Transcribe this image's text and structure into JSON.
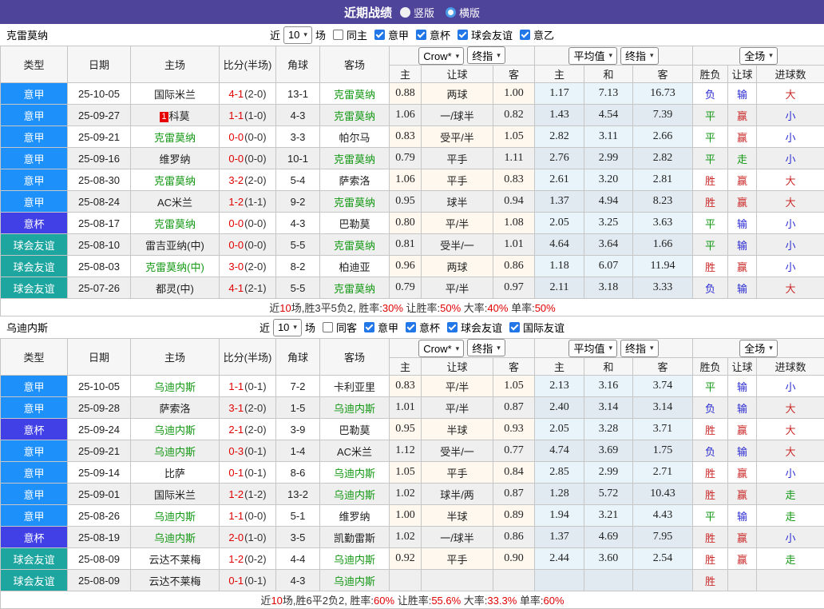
{
  "title_bar": {
    "title": "近期战绩",
    "vertical_label": "竖版",
    "horizontal_label": "横版"
  },
  "icons": {
    "dropdown": "▾"
  },
  "colors": {
    "title_bar": "#4e4499",
    "type_colors": {
      "意甲": "#1e90fa",
      "意杯": "#4140e6",
      "球会友谊": "#1da69f"
    },
    "team_focus": "#139813",
    "score": "#e00000",
    "result": {
      "r": "#cb2a2a",
      "g": "#139813",
      "b": "#2b2bd2"
    },
    "checkbox_checked": "#2176e8"
  },
  "table_header": {
    "left_columns": [
      "类型",
      "日期",
      "主场",
      "比分(半场)",
      "角球",
      "客场"
    ],
    "odds_group_selects": [
      "Crow*",
      "终指"
    ],
    "avg_group_selects": [
      "平均值",
      "终指"
    ],
    "result_group_select": "全场",
    "sub_columns": [
      "主",
      "让球",
      "客",
      "主",
      "和",
      "客",
      "胜负",
      "让球",
      "进球数"
    ]
  },
  "sections": [
    {
      "team": "克雷莫纳",
      "filter": {
        "near": "近",
        "count": "10",
        "games": "场",
        "scope": {
          "label": "同主",
          "checked": false
        },
        "leagues": [
          {
            "label": "意甲",
            "checked": true
          },
          {
            "label": "意杯",
            "checked": true
          },
          {
            "label": "球会友谊",
            "checked": true
          },
          {
            "label": "意乙",
            "checked": true
          }
        ]
      },
      "rows": [
        {
          "type": "意甲",
          "date": "25-10-05",
          "home": "国际米兰",
          "home_focus": false,
          "home_badge": "",
          "score": "4-1",
          "half": "(2-0)",
          "corner": "13-1",
          "away": "克雷莫纳",
          "away_focus": true,
          "odds": [
            "0.88",
            "两球",
            "1.00"
          ],
          "avg": [
            "1.17",
            "7.13",
            "16.73"
          ],
          "results": [
            [
              "负",
              "b"
            ],
            [
              "输",
              "b"
            ],
            [
              "大",
              "r"
            ]
          ]
        },
        {
          "type": "意甲",
          "date": "25-09-27",
          "home": "科莫",
          "home_focus": false,
          "home_badge": "1",
          "score": "1-1",
          "half": "(1-0)",
          "corner": "4-3",
          "away": "克雷莫纳",
          "away_focus": true,
          "odds": [
            "1.06",
            "一/球半",
            "0.82"
          ],
          "avg": [
            "1.43",
            "4.54",
            "7.39"
          ],
          "results": [
            [
              "平",
              "g"
            ],
            [
              "赢",
              "r"
            ],
            [
              "小",
              "b"
            ]
          ]
        },
        {
          "type": "意甲",
          "date": "25-09-21",
          "home": "克雷莫纳",
          "home_focus": true,
          "home_badge": "",
          "score": "0-0",
          "half": "(0-0)",
          "corner": "3-3",
          "away": "帕尔马",
          "away_focus": false,
          "odds": [
            "0.83",
            "受平/半",
            "1.05"
          ],
          "avg": [
            "2.82",
            "3.11",
            "2.66"
          ],
          "results": [
            [
              "平",
              "g"
            ],
            [
              "赢",
              "r"
            ],
            [
              "小",
              "b"
            ]
          ]
        },
        {
          "type": "意甲",
          "date": "25-09-16",
          "home": "维罗纳",
          "home_focus": false,
          "home_badge": "",
          "score": "0-0",
          "half": "(0-0)",
          "corner": "10-1",
          "away": "克雷莫纳",
          "away_focus": true,
          "odds": [
            "0.79",
            "平手",
            "1.11"
          ],
          "avg": [
            "2.76",
            "2.99",
            "2.82"
          ],
          "results": [
            [
              "平",
              "g"
            ],
            [
              "走",
              "g"
            ],
            [
              "小",
              "b"
            ]
          ]
        },
        {
          "type": "意甲",
          "date": "25-08-30",
          "home": "克雷莫纳",
          "home_focus": true,
          "home_badge": "",
          "score": "3-2",
          "half": "(2-0)",
          "corner": "5-4",
          "away": "萨索洛",
          "away_focus": false,
          "odds": [
            "1.06",
            "平手",
            "0.83"
          ],
          "avg": [
            "2.61",
            "3.20",
            "2.81"
          ],
          "results": [
            [
              "胜",
              "r"
            ],
            [
              "赢",
              "r"
            ],
            [
              "大",
              "r"
            ]
          ]
        },
        {
          "type": "意甲",
          "date": "25-08-24",
          "home": "AC米兰",
          "home_focus": false,
          "home_badge": "",
          "score": "1-2",
          "half": "(1-1)",
          "corner": "9-2",
          "away": "克雷莫纳",
          "away_focus": true,
          "odds": [
            "0.95",
            "球半",
            "0.94"
          ],
          "avg": [
            "1.37",
            "4.94",
            "8.23"
          ],
          "results": [
            [
              "胜",
              "r"
            ],
            [
              "赢",
              "r"
            ],
            [
              "大",
              "r"
            ]
          ]
        },
        {
          "type": "意杯",
          "date": "25-08-17",
          "home": "克雷莫纳",
          "home_focus": true,
          "home_badge": "",
          "score": "0-0",
          "half": "(0-0)",
          "corner": "4-3",
          "away": "巴勒莫",
          "away_focus": false,
          "odds": [
            "0.80",
            "平/半",
            "1.08"
          ],
          "avg": [
            "2.05",
            "3.25",
            "3.63"
          ],
          "results": [
            [
              "平",
              "g"
            ],
            [
              "输",
              "b"
            ],
            [
              "小",
              "b"
            ]
          ]
        },
        {
          "type": "球会友谊",
          "date": "25-08-10",
          "home": "雷吉亚纳(中)",
          "home_focus": false,
          "home_badge": "",
          "score": "0-0",
          "half": "(0-0)",
          "corner": "5-5",
          "away": "克雷莫纳",
          "away_focus": true,
          "odds": [
            "0.81",
            "受半/一",
            "1.01"
          ],
          "avg": [
            "4.64",
            "3.64",
            "1.66"
          ],
          "results": [
            [
              "平",
              "g"
            ],
            [
              "输",
              "b"
            ],
            [
              "小",
              "b"
            ]
          ]
        },
        {
          "type": "球会友谊",
          "date": "25-08-03",
          "home": "克雷莫纳(中)",
          "home_focus": true,
          "home_badge": "",
          "score": "3-0",
          "half": "(2-0)",
          "corner": "8-2",
          "away": "柏迪亚",
          "away_focus": false,
          "odds": [
            "0.96",
            "两球",
            "0.86"
          ],
          "avg": [
            "1.18",
            "6.07",
            "11.94"
          ],
          "results": [
            [
              "胜",
              "r"
            ],
            [
              "赢",
              "r"
            ],
            [
              "小",
              "b"
            ]
          ]
        },
        {
          "type": "球会友谊",
          "date": "25-07-26",
          "home": "都灵(中)",
          "home_focus": false,
          "home_badge": "",
          "score": "4-1",
          "half": "(2-1)",
          "corner": "5-5",
          "away": "克雷莫纳",
          "away_focus": true,
          "odds": [
            "0.79",
            "平/半",
            "0.97"
          ],
          "avg": [
            "2.11",
            "3.18",
            "3.33"
          ],
          "results": [
            [
              "负",
              "b"
            ],
            [
              "输",
              "b"
            ],
            [
              "大",
              "r"
            ]
          ]
        }
      ],
      "summary": [
        {
          "text": "近",
          "red": false
        },
        {
          "text": "10",
          "red": true
        },
        {
          "text": "场,胜3平5负2, 胜率:",
          "red": false
        },
        {
          "text": "30%",
          "red": true
        },
        {
          "text": " 让胜率:",
          "red": false
        },
        {
          "text": "50%",
          "red": true
        },
        {
          "text": " 大率:",
          "red": false
        },
        {
          "text": "40%",
          "red": true
        },
        {
          "text": " 单率:",
          "red": false
        },
        {
          "text": "50%",
          "red": true
        }
      ]
    },
    {
      "team": "乌迪内斯",
      "filter": {
        "near": "近",
        "count": "10",
        "games": "场",
        "scope": {
          "label": "同客",
          "checked": false
        },
        "leagues": [
          {
            "label": "意甲",
            "checked": true
          },
          {
            "label": "意杯",
            "checked": true
          },
          {
            "label": "球会友谊",
            "checked": true
          },
          {
            "label": "国际友谊",
            "checked": true
          }
        ]
      },
      "rows": [
        {
          "type": "意甲",
          "date": "25-10-05",
          "home": "乌迪内斯",
          "home_focus": true,
          "home_badge": "",
          "score": "1-1",
          "half": "(0-1)",
          "corner": "7-2",
          "away": "卡利亚里",
          "away_focus": false,
          "odds": [
            "0.83",
            "平/半",
            "1.05"
          ],
          "avg": [
            "2.13",
            "3.16",
            "3.74"
          ],
          "results": [
            [
              "平",
              "g"
            ],
            [
              "输",
              "b"
            ],
            [
              "小",
              "b"
            ]
          ]
        },
        {
          "type": "意甲",
          "date": "25-09-28",
          "home": "萨索洛",
          "home_focus": false,
          "home_badge": "",
          "score": "3-1",
          "half": "(2-0)",
          "corner": "1-5",
          "away": "乌迪内斯",
          "away_focus": true,
          "odds": [
            "1.01",
            "平/半",
            "0.87"
          ],
          "avg": [
            "2.40",
            "3.14",
            "3.14"
          ],
          "results": [
            [
              "负",
              "b"
            ],
            [
              "输",
              "b"
            ],
            [
              "大",
              "r"
            ]
          ]
        },
        {
          "type": "意杯",
          "date": "25-09-24",
          "home": "乌迪内斯",
          "home_focus": true,
          "home_badge": "",
          "score": "2-1",
          "half": "(2-0)",
          "corner": "3-9",
          "away": "巴勒莫",
          "away_focus": false,
          "odds": [
            "0.95",
            "半球",
            "0.93"
          ],
          "avg": [
            "2.05",
            "3.28",
            "3.71"
          ],
          "results": [
            [
              "胜",
              "r"
            ],
            [
              "赢",
              "r"
            ],
            [
              "大",
              "r"
            ]
          ]
        },
        {
          "type": "意甲",
          "date": "25-09-21",
          "home": "乌迪内斯",
          "home_focus": true,
          "home_badge": "",
          "score": "0-3",
          "half": "(0-1)",
          "corner": "1-4",
          "away": "AC米兰",
          "away_focus": false,
          "odds": [
            "1.12",
            "受半/一",
            "0.77"
          ],
          "avg": [
            "4.74",
            "3.69",
            "1.75"
          ],
          "results": [
            [
              "负",
              "b"
            ],
            [
              "输",
              "b"
            ],
            [
              "大",
              "r"
            ]
          ]
        },
        {
          "type": "意甲",
          "date": "25-09-14",
          "home": "比萨",
          "home_focus": false,
          "home_badge": "",
          "score": "0-1",
          "half": "(0-1)",
          "corner": "8-6",
          "away": "乌迪内斯",
          "away_focus": true,
          "odds": [
            "1.05",
            "平手",
            "0.84"
          ],
          "avg": [
            "2.85",
            "2.99",
            "2.71"
          ],
          "results": [
            [
              "胜",
              "r"
            ],
            [
              "赢",
              "r"
            ],
            [
              "小",
              "b"
            ]
          ]
        },
        {
          "type": "意甲",
          "date": "25-09-01",
          "home": "国际米兰",
          "home_focus": false,
          "home_badge": "",
          "score": "1-2",
          "half": "(1-2)",
          "corner": "13-2",
          "away": "乌迪内斯",
          "away_focus": true,
          "odds": [
            "1.02",
            "球半/两",
            "0.87"
          ],
          "avg": [
            "1.28",
            "5.72",
            "10.43"
          ],
          "results": [
            [
              "胜",
              "r"
            ],
            [
              "赢",
              "r"
            ],
            [
              "走",
              "g"
            ]
          ]
        },
        {
          "type": "意甲",
          "date": "25-08-26",
          "home": "乌迪内斯",
          "home_focus": true,
          "home_badge": "",
          "score": "1-1",
          "half": "(0-0)",
          "corner": "5-1",
          "away": "维罗纳",
          "away_focus": false,
          "odds": [
            "1.00",
            "半球",
            "0.89"
          ],
          "avg": [
            "1.94",
            "3.21",
            "4.43"
          ],
          "results": [
            [
              "平",
              "g"
            ],
            [
              "输",
              "b"
            ],
            [
              "走",
              "g"
            ]
          ]
        },
        {
          "type": "意杯",
          "date": "25-08-19",
          "home": "乌迪内斯",
          "home_focus": true,
          "home_badge": "",
          "score": "2-0",
          "half": "(1-0)",
          "corner": "3-5",
          "away": "凯勤雷斯",
          "away_focus": false,
          "odds": [
            "1.02",
            "一/球半",
            "0.86"
          ],
          "avg": [
            "1.37",
            "4.69",
            "7.95"
          ],
          "results": [
            [
              "胜",
              "r"
            ],
            [
              "赢",
              "r"
            ],
            [
              "小",
              "b"
            ]
          ]
        },
        {
          "type": "球会友谊",
          "date": "25-08-09",
          "home": "云达不莱梅",
          "home_focus": false,
          "home_badge": "",
          "score": "1-2",
          "half": "(0-2)",
          "corner": "4-4",
          "away": "乌迪内斯",
          "away_focus": true,
          "odds": [
            "0.92",
            "平手",
            "0.90"
          ],
          "avg": [
            "2.44",
            "3.60",
            "2.54"
          ],
          "results": [
            [
              "胜",
              "r"
            ],
            [
              "赢",
              "r"
            ],
            [
              "走",
              "g"
            ]
          ]
        },
        {
          "type": "球会友谊",
          "date": "25-08-09",
          "home": "云达不莱梅",
          "home_focus": false,
          "home_badge": "",
          "score": "0-1",
          "half": "(0-1)",
          "corner": "4-3",
          "away": "乌迪内斯",
          "away_focus": true,
          "odds": [
            "",
            "",
            ""
          ],
          "avg": [
            "",
            "",
            ""
          ],
          "results": [
            [
              "胜",
              "r"
            ],
            [
              "",
              ""
            ],
            [
              "",
              ""
            ]
          ]
        }
      ],
      "summary": [
        {
          "text": "近",
          "red": false
        },
        {
          "text": "10",
          "red": true
        },
        {
          "text": "场,胜6平2负2, 胜率:",
          "red": false
        },
        {
          "text": "60%",
          "red": true
        },
        {
          "text": " 让胜率:",
          "red": false
        },
        {
          "text": "55.6%",
          "red": true
        },
        {
          "text": " 大率:",
          "red": false
        },
        {
          "text": "33.3%",
          "red": true
        },
        {
          "text": " 单率:",
          "red": false
        },
        {
          "text": "60%",
          "red": true
        }
      ]
    }
  ]
}
